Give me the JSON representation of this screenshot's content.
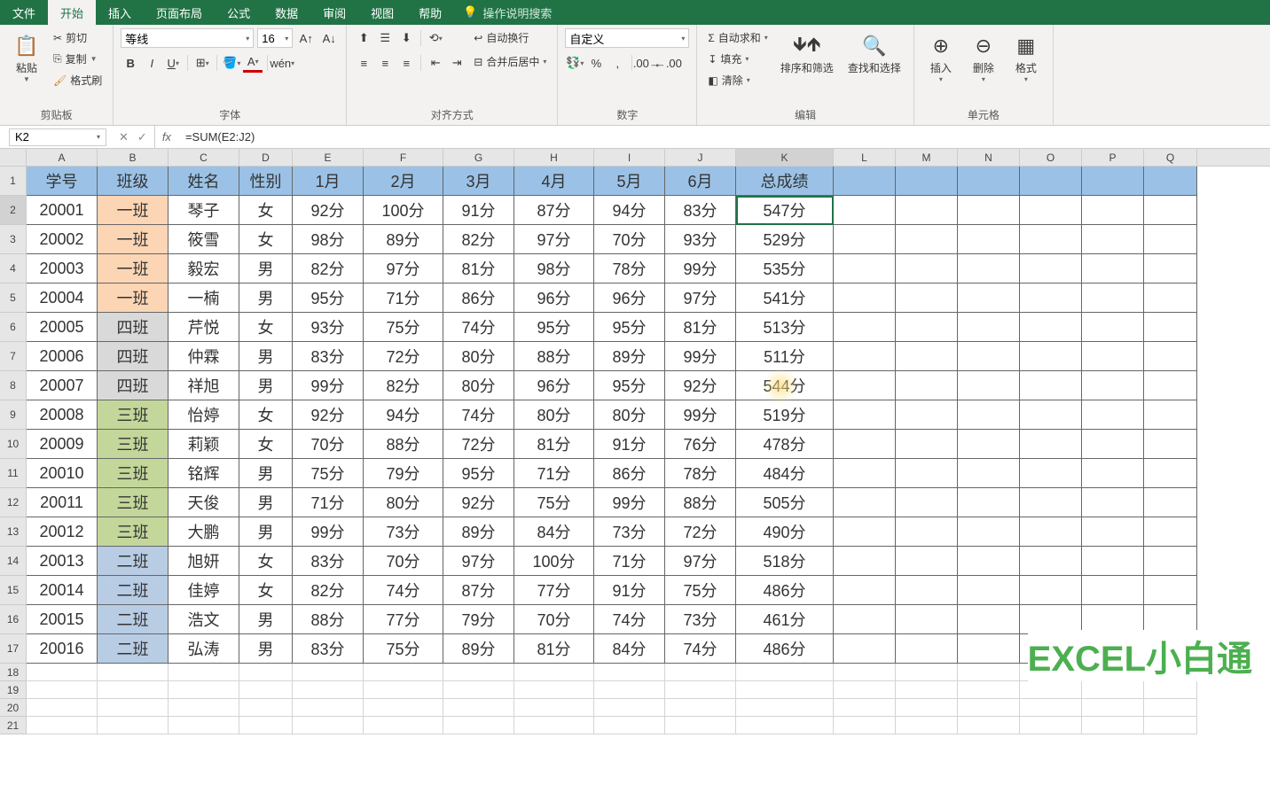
{
  "menu": {
    "file": "文件",
    "home": "开始",
    "insert": "插入",
    "layout": "页面布局",
    "formula": "公式",
    "data": "数据",
    "review": "审阅",
    "view": "视图",
    "help": "帮助",
    "tell": "操作说明搜索"
  },
  "ribbon": {
    "clipboard": {
      "label": "剪贴板",
      "paste": "粘贴",
      "cut": "剪切",
      "copy": "复制",
      "painter": "格式刷"
    },
    "font": {
      "label": "字体",
      "name": "等线",
      "size": "16"
    },
    "align": {
      "label": "对齐方式",
      "wrap": "自动换行",
      "merge": "合并后居中"
    },
    "number": {
      "label": "数字",
      "format": "自定义"
    },
    "edit": {
      "label": "编辑",
      "sum": "自动求和",
      "fill": "填充",
      "clear": "清除",
      "sort": "排序和筛选",
      "find": "查找和选择"
    },
    "cells": {
      "label": "单元格",
      "insert": "插入",
      "delete": "删除",
      "format": "格式"
    }
  },
  "namebox": "K2",
  "formula": "=SUM(E2:J2)",
  "columns": [
    "A",
    "B",
    "C",
    "D",
    "E",
    "F",
    "G",
    "H",
    "I",
    "J",
    "K",
    "L",
    "M",
    "N",
    "O",
    "P",
    "Q"
  ],
  "headers": [
    "学号",
    "班级",
    "姓名",
    "性别",
    "1月",
    "2月",
    "3月",
    "4月",
    "5月",
    "6月",
    "总成绩"
  ],
  "rows": [
    {
      "id": "20001",
      "cls": "一班",
      "name": "琴子",
      "sex": "女",
      "m": [
        "92分",
        "100分",
        "91分",
        "87分",
        "94分",
        "83分"
      ],
      "total": "547分"
    },
    {
      "id": "20002",
      "cls": "一班",
      "name": "筱雪",
      "sex": "女",
      "m": [
        "98分",
        "89分",
        "82分",
        "97分",
        "70分",
        "93分"
      ],
      "total": "529分"
    },
    {
      "id": "20003",
      "cls": "一班",
      "name": "毅宏",
      "sex": "男",
      "m": [
        "82分",
        "97分",
        "81分",
        "98分",
        "78分",
        "99分"
      ],
      "total": "535分"
    },
    {
      "id": "20004",
      "cls": "一班",
      "name": "一楠",
      "sex": "男",
      "m": [
        "95分",
        "71分",
        "86分",
        "96分",
        "96分",
        "97分"
      ],
      "total": "541分"
    },
    {
      "id": "20005",
      "cls": "四班",
      "name": "芹悦",
      "sex": "女",
      "m": [
        "93分",
        "75分",
        "74分",
        "95分",
        "95分",
        "81分"
      ],
      "total": "513分"
    },
    {
      "id": "20006",
      "cls": "四班",
      "name": "仲霖",
      "sex": "男",
      "m": [
        "83分",
        "72分",
        "80分",
        "88分",
        "89分",
        "99分"
      ],
      "total": "511分"
    },
    {
      "id": "20007",
      "cls": "四班",
      "name": "祥旭",
      "sex": "男",
      "m": [
        "99分",
        "82分",
        "80分",
        "96分",
        "95分",
        "92分"
      ],
      "total": "544分"
    },
    {
      "id": "20008",
      "cls": "三班",
      "name": "怡婷",
      "sex": "女",
      "m": [
        "92分",
        "94分",
        "74分",
        "80分",
        "80分",
        "99分"
      ],
      "total": "519分"
    },
    {
      "id": "20009",
      "cls": "三班",
      "name": "莉颖",
      "sex": "女",
      "m": [
        "70分",
        "88分",
        "72分",
        "81分",
        "91分",
        "76分"
      ],
      "total": "478分"
    },
    {
      "id": "20010",
      "cls": "三班",
      "name": "铭辉",
      "sex": "男",
      "m": [
        "75分",
        "79分",
        "95分",
        "71分",
        "86分",
        "78分"
      ],
      "total": "484分"
    },
    {
      "id": "20011",
      "cls": "三班",
      "name": "天俊",
      "sex": "男",
      "m": [
        "71分",
        "80分",
        "92分",
        "75分",
        "99分",
        "88分"
      ],
      "total": "505分"
    },
    {
      "id": "20012",
      "cls": "三班",
      "name": "大鹏",
      "sex": "男",
      "m": [
        "99分",
        "73分",
        "89分",
        "84分",
        "73分",
        "72分"
      ],
      "total": "490分"
    },
    {
      "id": "20013",
      "cls": "二班",
      "name": "旭妍",
      "sex": "女",
      "m": [
        "83分",
        "70分",
        "97分",
        "100分",
        "71分",
        "97分"
      ],
      "total": "518分"
    },
    {
      "id": "20014",
      "cls": "二班",
      "name": "佳婷",
      "sex": "女",
      "m": [
        "82分",
        "74分",
        "87分",
        "77分",
        "91分",
        "75分"
      ],
      "total": "486分"
    },
    {
      "id": "20015",
      "cls": "二班",
      "name": "浩文",
      "sex": "男",
      "m": [
        "88分",
        "77分",
        "79分",
        "70分",
        "74分",
        "73分"
      ],
      "total": "461分"
    },
    {
      "id": "20016",
      "cls": "二班",
      "name": "弘涛",
      "sex": "男",
      "m": [
        "83分",
        "75分",
        "89分",
        "81分",
        "84分",
        "74分"
      ],
      "total": "486分"
    }
  ],
  "watermark": "EXCEL小白通"
}
